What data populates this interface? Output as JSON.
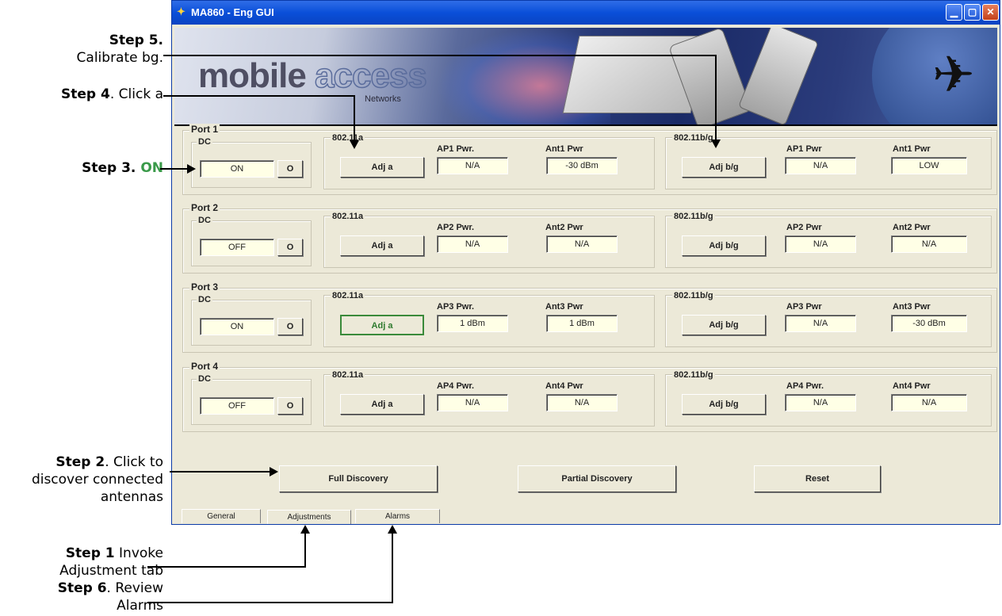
{
  "window": {
    "title": "MA860 - Eng GUI",
    "minimize": "▁",
    "maximize": "▢",
    "close": "✕"
  },
  "banner": {
    "logo_main": "mobile",
    "logo_accent": "access",
    "logo_sub": "Networks"
  },
  "dc_label": "DC",
  "ports": [
    {
      "label": "Port 1",
      "dc_state": "ON",
      "dc_btn": "O",
      "a_group": "802.11a",
      "a_btn": "Adj  a",
      "ap_a_label": "AP1 Pwr.",
      "ap_a_value": "N/A",
      "ant_a_label": "Ant1 Pwr",
      "ant_a_value": "-30 dBm",
      "bg_group": "802.11b/g",
      "bg_btn": "Adj b/g",
      "ap_bg_label": "AP1 Pwr",
      "ap_bg_value": "N/A",
      "ant_bg_label": "Ant1 Pwr",
      "ant_bg_value": "LOW"
    },
    {
      "label": "Port 2",
      "dc_state": "OFF",
      "dc_btn": "O",
      "a_group": "802.11a",
      "a_btn": "Adj  a",
      "ap_a_label": "AP2 Pwr.",
      "ap_a_value": "N/A",
      "ant_a_label": "Ant2 Pwr",
      "ant_a_value": "N/A",
      "bg_group": "802.11b/g",
      "bg_btn": "Adj b/g",
      "ap_bg_label": "AP2 Pwr",
      "ap_bg_value": "N/A",
      "ant_bg_label": "Ant2 Pwr",
      "ant_bg_value": "N/A"
    },
    {
      "label": "Port 3",
      "dc_state": "ON",
      "dc_btn": "O",
      "a_group": "802.11a",
      "a_btn": "Adj  a",
      "ap_a_label": "AP3 Pwr.",
      "ap_a_value": "1 dBm",
      "ant_a_label": "Ant3 Pwr",
      "ant_a_value": "1 dBm",
      "bg_group": "802.11b/g",
      "bg_btn": "Adj b/g",
      "ap_bg_label": "AP3 Pwr",
      "ap_bg_value": "N/A",
      "ant_bg_label": "Ant3 Pwr",
      "ant_bg_value": "-30 dBm"
    },
    {
      "label": "Port 4",
      "dc_state": "OFF",
      "dc_btn": "O",
      "a_group": "802.11a",
      "a_btn": "Adj  a",
      "ap_a_label": "AP4 Pwr.",
      "ap_a_value": "N/A",
      "ant_a_label": "Ant4 Pwr",
      "ant_a_value": "N/A",
      "bg_group": "802.11b/g",
      "bg_btn": "Adj b/g",
      "ap_bg_label": "AP4 Pwr.",
      "ap_bg_value": "N/A",
      "ant_bg_label": "Ant4 Pwr",
      "ant_bg_value": "N/A"
    }
  ],
  "actions": {
    "full_discovery": "Full Discovery",
    "partial_discovery": "Partial Discovery",
    "reset": "Reset"
  },
  "tabs": [
    "General",
    "Adjustments",
    "Alarms"
  ],
  "active_tab": "Adjustments",
  "annotations": {
    "step5_bold": "Step 5",
    "step5_dot": ".",
    "step5_text": "Calibrate bg.",
    "step4_bold": "Step 4",
    "step4_text": ". Click a",
    "step3_bold": "Step 3",
    "step3_dot": ". ",
    "step3_green": "ON",
    "step2_bold": "Step 2",
    "step2_text1": ". Click to",
    "step2_text2": "discover connected",
    "step2_text3": "antennas",
    "step1_bold": "Step 1",
    "step1_text1": " Invoke",
    "step1_text2": "Adjustment tab",
    "step6_bold": "Step 6",
    "step6_text1": ". Review",
    "step6_text2": "Alarms"
  },
  "colors": {
    "annotation_green": "#3a9a4a",
    "field_bg": "#ffffe6",
    "window_bg": "#ece9d8",
    "titlebar": "#0a4fd9"
  }
}
